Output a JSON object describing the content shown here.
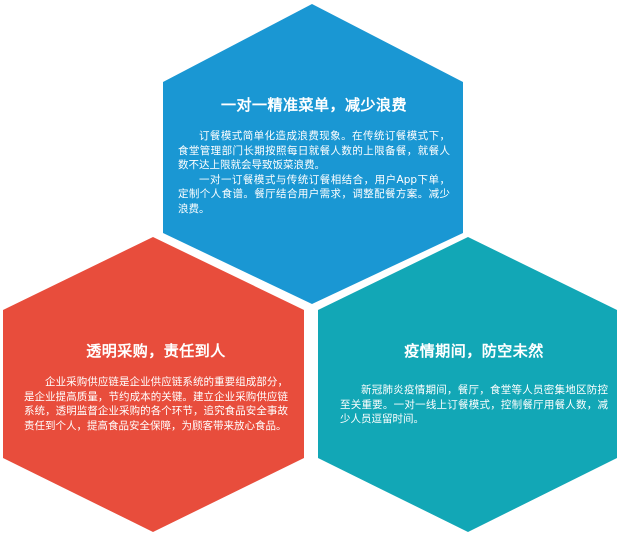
{
  "colors": {
    "top": "#1a97d3",
    "left": "#e84d3c",
    "right": "#12a7b6",
    "text": "#ffffff"
  },
  "top": {
    "title": "一对一精准菜单，减少浪费",
    "paragraphs": [
      "订餐模式简单化造成浪费现象。在传统订餐模式下，食堂管理部门长期按照每日就餐人数的上限备餐，就餐人数不达上限就会导致饭菜浪费。",
      "一对一订餐模式与传统订餐相结合，用户App下单，定制个人食谱。餐厅结合用户需求，调整配餐方案。减少浪费。"
    ]
  },
  "left": {
    "title": "透明采购，责任到人",
    "paragraphs": [
      "企业采购供应链是企业供应链系统的重要组成部分，是企业提高质量，节约成本的关键。建立企业采购供应链系统，透明监督企业采购的各个环节，追究食品安全事故责任到个人，提高食品安全保障，为顾客带来放心食品。"
    ]
  },
  "right": {
    "title": "疫情期间，防空未然",
    "paragraphs": [
      "新冠肺炎疫情期间，餐厅，食堂等人员密集地区防控至关重要。一对一线上订餐模式，控制餐厅用餐人数，减少人员逗留时间。"
    ]
  }
}
